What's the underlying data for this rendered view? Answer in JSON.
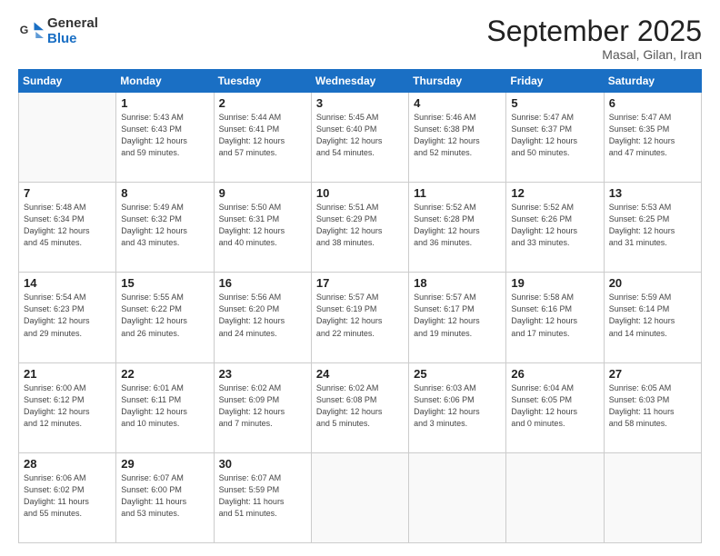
{
  "logo": {
    "line1": "General",
    "line2": "Blue"
  },
  "title": "September 2025",
  "location": "Masal, Gilan, Iran",
  "days_header": [
    "Sunday",
    "Monday",
    "Tuesday",
    "Wednesday",
    "Thursday",
    "Friday",
    "Saturday"
  ],
  "weeks": [
    [
      {
        "day": "",
        "info": ""
      },
      {
        "day": "1",
        "info": "Sunrise: 5:43 AM\nSunset: 6:43 PM\nDaylight: 12 hours\nand 59 minutes."
      },
      {
        "day": "2",
        "info": "Sunrise: 5:44 AM\nSunset: 6:41 PM\nDaylight: 12 hours\nand 57 minutes."
      },
      {
        "day": "3",
        "info": "Sunrise: 5:45 AM\nSunset: 6:40 PM\nDaylight: 12 hours\nand 54 minutes."
      },
      {
        "day": "4",
        "info": "Sunrise: 5:46 AM\nSunset: 6:38 PM\nDaylight: 12 hours\nand 52 minutes."
      },
      {
        "day": "5",
        "info": "Sunrise: 5:47 AM\nSunset: 6:37 PM\nDaylight: 12 hours\nand 50 minutes."
      },
      {
        "day": "6",
        "info": "Sunrise: 5:47 AM\nSunset: 6:35 PM\nDaylight: 12 hours\nand 47 minutes."
      }
    ],
    [
      {
        "day": "7",
        "info": "Sunrise: 5:48 AM\nSunset: 6:34 PM\nDaylight: 12 hours\nand 45 minutes."
      },
      {
        "day": "8",
        "info": "Sunrise: 5:49 AM\nSunset: 6:32 PM\nDaylight: 12 hours\nand 43 minutes."
      },
      {
        "day": "9",
        "info": "Sunrise: 5:50 AM\nSunset: 6:31 PM\nDaylight: 12 hours\nand 40 minutes."
      },
      {
        "day": "10",
        "info": "Sunrise: 5:51 AM\nSunset: 6:29 PM\nDaylight: 12 hours\nand 38 minutes."
      },
      {
        "day": "11",
        "info": "Sunrise: 5:52 AM\nSunset: 6:28 PM\nDaylight: 12 hours\nand 36 minutes."
      },
      {
        "day": "12",
        "info": "Sunrise: 5:52 AM\nSunset: 6:26 PM\nDaylight: 12 hours\nand 33 minutes."
      },
      {
        "day": "13",
        "info": "Sunrise: 5:53 AM\nSunset: 6:25 PM\nDaylight: 12 hours\nand 31 minutes."
      }
    ],
    [
      {
        "day": "14",
        "info": "Sunrise: 5:54 AM\nSunset: 6:23 PM\nDaylight: 12 hours\nand 29 minutes."
      },
      {
        "day": "15",
        "info": "Sunrise: 5:55 AM\nSunset: 6:22 PM\nDaylight: 12 hours\nand 26 minutes."
      },
      {
        "day": "16",
        "info": "Sunrise: 5:56 AM\nSunset: 6:20 PM\nDaylight: 12 hours\nand 24 minutes."
      },
      {
        "day": "17",
        "info": "Sunrise: 5:57 AM\nSunset: 6:19 PM\nDaylight: 12 hours\nand 22 minutes."
      },
      {
        "day": "18",
        "info": "Sunrise: 5:57 AM\nSunset: 6:17 PM\nDaylight: 12 hours\nand 19 minutes."
      },
      {
        "day": "19",
        "info": "Sunrise: 5:58 AM\nSunset: 6:16 PM\nDaylight: 12 hours\nand 17 minutes."
      },
      {
        "day": "20",
        "info": "Sunrise: 5:59 AM\nSunset: 6:14 PM\nDaylight: 12 hours\nand 14 minutes."
      }
    ],
    [
      {
        "day": "21",
        "info": "Sunrise: 6:00 AM\nSunset: 6:12 PM\nDaylight: 12 hours\nand 12 minutes."
      },
      {
        "day": "22",
        "info": "Sunrise: 6:01 AM\nSunset: 6:11 PM\nDaylight: 12 hours\nand 10 minutes."
      },
      {
        "day": "23",
        "info": "Sunrise: 6:02 AM\nSunset: 6:09 PM\nDaylight: 12 hours\nand 7 minutes."
      },
      {
        "day": "24",
        "info": "Sunrise: 6:02 AM\nSunset: 6:08 PM\nDaylight: 12 hours\nand 5 minutes."
      },
      {
        "day": "25",
        "info": "Sunrise: 6:03 AM\nSunset: 6:06 PM\nDaylight: 12 hours\nand 3 minutes."
      },
      {
        "day": "26",
        "info": "Sunrise: 6:04 AM\nSunset: 6:05 PM\nDaylight: 12 hours\nand 0 minutes."
      },
      {
        "day": "27",
        "info": "Sunrise: 6:05 AM\nSunset: 6:03 PM\nDaylight: 11 hours\nand 58 minutes."
      }
    ],
    [
      {
        "day": "28",
        "info": "Sunrise: 6:06 AM\nSunset: 6:02 PM\nDaylight: 11 hours\nand 55 minutes."
      },
      {
        "day": "29",
        "info": "Sunrise: 6:07 AM\nSunset: 6:00 PM\nDaylight: 11 hours\nand 53 minutes."
      },
      {
        "day": "30",
        "info": "Sunrise: 6:07 AM\nSunset: 5:59 PM\nDaylight: 11 hours\nand 51 minutes."
      },
      {
        "day": "",
        "info": ""
      },
      {
        "day": "",
        "info": ""
      },
      {
        "day": "",
        "info": ""
      },
      {
        "day": "",
        "info": ""
      }
    ]
  ]
}
